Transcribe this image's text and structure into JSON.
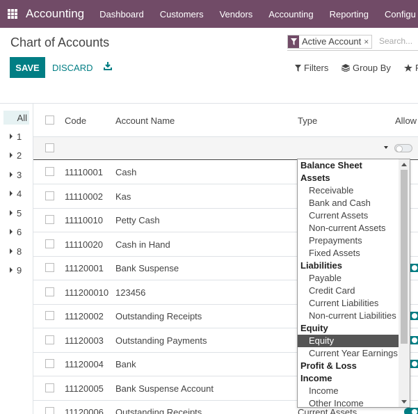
{
  "navbar": {
    "app_name": "Accounting",
    "menu": [
      "Dashboard",
      "Customers",
      "Vendors",
      "Accounting",
      "Reporting",
      "Configu"
    ]
  },
  "control_panel": {
    "title": "Chart of Accounts",
    "save_label": "SAVE",
    "discard_label": "DISCARD",
    "facet_value": "Active Account",
    "facet_close": "×",
    "search_placeholder": "Search...",
    "filters_label": "Filters",
    "group_by_label": "Group By",
    "favorites_label": "F"
  },
  "side_panel": {
    "items": [
      "All",
      "1",
      "2",
      "3",
      "4",
      "5",
      "6",
      "8",
      "9"
    ]
  },
  "table": {
    "columns": [
      "Code",
      "Account Name",
      "Type",
      "Allow"
    ],
    "rows": [
      {
        "code": "11110001",
        "name": "Cash",
        "type": ""
      },
      {
        "code": "11110002",
        "name": "Kas",
        "type": ""
      },
      {
        "code": "11110010",
        "name": "Petty Cash",
        "type": ""
      },
      {
        "code": "11110020",
        "name": "Cash in Hand",
        "type": ""
      },
      {
        "code": "11120001",
        "name": "Bank Suspense",
        "type": ""
      },
      {
        "code": "111200010",
        "name": "123456",
        "type": ""
      },
      {
        "code": "11120002",
        "name": "Outstanding Receipts",
        "type": ""
      },
      {
        "code": "11120003",
        "name": "Outstanding Payments",
        "type": ""
      },
      {
        "code": "11120004",
        "name": "Bank",
        "type": ""
      },
      {
        "code": "11120005",
        "name": "Bank Suspense Account",
        "type": ""
      },
      {
        "code": "11120006",
        "name": "Outstanding Receipts",
        "type": "Current Assets"
      }
    ]
  },
  "type_dropdown": {
    "items": [
      {
        "label": "Balance Sheet",
        "group": true
      },
      {
        "label": "Assets",
        "group": true
      },
      {
        "label": "Receivable",
        "group": false
      },
      {
        "label": "Bank and Cash",
        "group": false
      },
      {
        "label": "Current Assets",
        "group": false
      },
      {
        "label": "Non-current Assets",
        "group": false
      },
      {
        "label": "Prepayments",
        "group": false
      },
      {
        "label": "Fixed Assets",
        "group": false
      },
      {
        "label": "Liabilities",
        "group": true
      },
      {
        "label": "Payable",
        "group": false
      },
      {
        "label": "Credit Card",
        "group": false
      },
      {
        "label": "Current Liabilities",
        "group": false
      },
      {
        "label": "Non-current Liabilities",
        "group": false
      },
      {
        "label": "Equity",
        "group": true
      },
      {
        "label": "Equity",
        "group": false,
        "selected": true
      },
      {
        "label": "Current Year Earnings",
        "group": false
      },
      {
        "label": "Profit & Loss",
        "group": true
      },
      {
        "label": "Income",
        "group": true
      },
      {
        "label": "Income",
        "group": false
      },
      {
        "label": "Other Income",
        "group": false
      }
    ]
  },
  "colors": {
    "brand": "#714b67",
    "primary": "#017e84"
  }
}
